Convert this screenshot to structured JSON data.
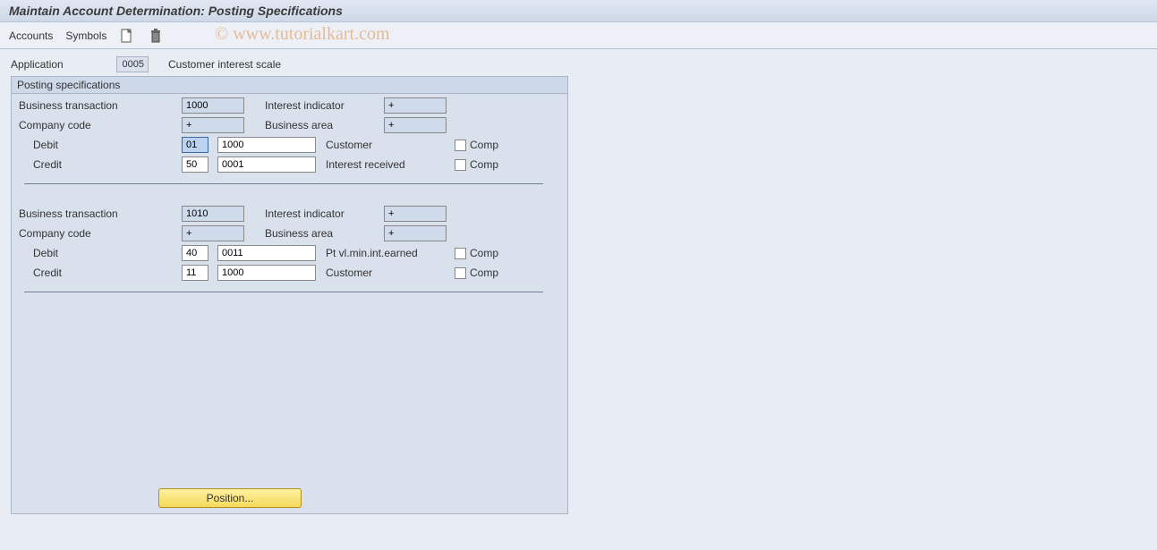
{
  "title": "Maintain Account Determination: Posting Specifications",
  "toolbar": {
    "accounts": "Accounts",
    "symbols": "Symbols"
  },
  "watermark": "© www.tutorialkart.com",
  "app": {
    "label": "Application",
    "code": "0005",
    "desc": "Customer interest scale"
  },
  "group_title": "Posting specifications",
  "labels": {
    "bus_trans": "Business transaction",
    "int_ind": "Interest indicator",
    "comp_code": "Company code",
    "bus_area": "Business area",
    "debit": "Debit",
    "credit": "Credit",
    "comp": "Comp"
  },
  "sections": [
    {
      "bus_trans": "1000",
      "int_ind": "+",
      "comp_code": "+",
      "bus_area": "+",
      "debit_key": "01",
      "debit_key_selected": true,
      "debit_acc": "1000",
      "debit_desc": "Customer",
      "debit_comp": false,
      "credit_key": "50",
      "credit_acc": "0001",
      "credit_desc": "Interest received",
      "credit_comp": false
    },
    {
      "bus_trans": "1010",
      "int_ind": "+",
      "comp_code": "+",
      "bus_area": "+",
      "debit_key": "40",
      "debit_key_selected": false,
      "debit_acc": "0011",
      "debit_desc": "Pt vl.min.int.earned",
      "debit_comp": false,
      "credit_key": "11",
      "credit_acc": "1000",
      "credit_desc": "Customer",
      "credit_comp": false
    }
  ],
  "position_btn": "Position..."
}
